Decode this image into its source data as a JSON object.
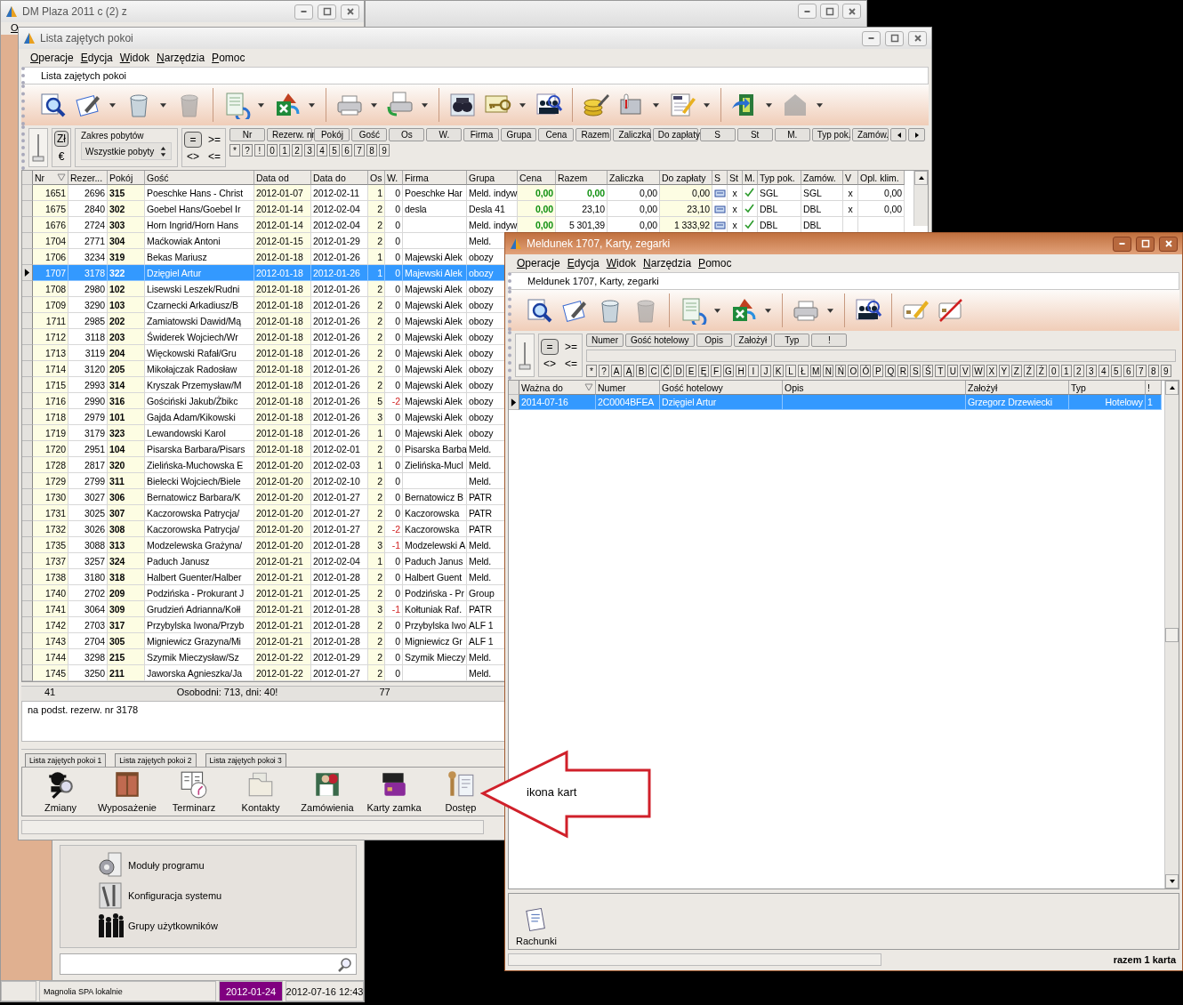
{
  "main_window": {
    "title": "DM Plaza 2011 c (2) z",
    "menu": [
      "O"
    ],
    "modules": [
      "Moduły programu",
      "Konfiguracja systemu",
      "Grupy użytkowników"
    ],
    "status_bar": {
      "location": "Magnolia SPA lokalnie",
      "work_date": "2012-01-24",
      "clock": "2012-07-16 12:43"
    }
  },
  "list_window": {
    "title": "Lista zajętych pokoi",
    "menu": [
      "Operacje",
      "Edycja",
      "Widok",
      "Narzędzia",
      "Pomoc"
    ],
    "caption": "Lista zajętych pokoi",
    "filter": {
      "currency": [
        {
          "label": "Zł",
          "selected": true
        },
        {
          "label": "€",
          "selected": false
        }
      ],
      "range_label": "Zakres pobytów",
      "range_value": "Wszystkie pobyty",
      "operators": [
        {
          "label": "=",
          "selected": true
        },
        {
          "label": ">=",
          "selected": false
        },
        {
          "label": "<>",
          "selected": false
        },
        {
          "label": "<=",
          "selected": false
        }
      ],
      "column_buttons": [
        "Nr",
        "Rezerw. nr",
        "Pokój",
        "Gość",
        "Os",
        "W.",
        "Firma",
        "Grupa",
        "Cena",
        "Razem",
        "Zaliczka",
        "Do zapłaty",
        "S",
        "St",
        "M.",
        "Typ pok.",
        "Zamów."
      ],
      "quick_keys": [
        "*",
        "?",
        "!",
        "0",
        "1",
        "2",
        "3",
        "4",
        "5",
        "6",
        "7",
        "8",
        "9"
      ]
    },
    "table": {
      "columns": [
        {
          "label": "Nr",
          "sorted": true
        },
        {
          "label": "Rezer...",
          "sorted": false
        },
        {
          "label": "Pokój",
          "sorted": false
        },
        {
          "label": "Gość",
          "sorted": false
        },
        {
          "label": "Data od",
          "sorted": false
        },
        {
          "label": "Data do",
          "sorted": false
        },
        {
          "label": "Os",
          "sorted": false
        },
        {
          "label": "W.",
          "sorted": false
        },
        {
          "label": "Firma",
          "sorted": false
        },
        {
          "label": "Grupa",
          "sorted": false
        },
        {
          "label": "Cena",
          "sorted": false
        },
        {
          "label": "Razem",
          "sorted": false
        },
        {
          "label": "Zaliczka",
          "sorted": false
        },
        {
          "label": "Do zapłaty",
          "sorted": false
        },
        {
          "label": "S",
          "sorted": false
        },
        {
          "label": "St",
          "sorted": false
        },
        {
          "label": "M.",
          "sorted": false
        },
        {
          "label": "Typ pok.",
          "sorted": false
        },
        {
          "label": "Zamów.",
          "sorted": false
        },
        {
          "label": "V",
          "sorted": false
        },
        {
          "label": "Opl. klim.",
          "sorted": false
        }
      ],
      "rows": [
        {
          "nr": "1651",
          "rez": "2696",
          "room": "315",
          "guest": "Poeschke Hans - Christ",
          "from": "2012-01-07",
          "to": "2012-02-11",
          "persons": "1",
          "w": "0",
          "w_red": false,
          "company": "Poeschke Har",
          "group": "Meld. indyw",
          "selected": false,
          "charges": {
            "cena": "0,00",
            "razem": "0,00",
            "razem_green": true,
            "zaliczka": "0,00",
            "do_zaplaty": "0,00",
            "st": "x",
            "m_checked": true,
            "typ_pok": "SGL",
            "zamow": "SGL",
            "v": "x",
            "opl": "0,00"
          }
        },
        {
          "nr": "1675",
          "rez": "2840",
          "room": "302",
          "guest": "Goebel Hans/Goebel Ir",
          "from": "2012-01-14",
          "to": "2012-02-04",
          "persons": "2",
          "w": "0",
          "w_red": false,
          "company": "desla",
          "group": "Desla 41",
          "selected": false,
          "charges": {
            "cena": "0,00",
            "razem": "23,10",
            "razem_green": false,
            "zaliczka": "0,00",
            "do_zaplaty": "23,10",
            "st": "x",
            "m_checked": true,
            "typ_pok": "DBL",
            "zamow": "DBL",
            "v": "x",
            "opl": "0,00"
          }
        },
        {
          "nr": "1676",
          "rez": "2724",
          "room": "303",
          "guest": "Horn Ingrid/Horn Hans",
          "from": "2012-01-14",
          "to": "2012-02-04",
          "persons": "2",
          "w": "0",
          "w_red": false,
          "group": "Meld. indyw",
          "selected": false,
          "charges": {
            "cena": "0,00",
            "razem": "5 301,39",
            "razem_green": false,
            "zaliczka": "0,00",
            "do_zaplaty": "1 333,92",
            "st": "x",
            "m_checked": true,
            "typ_pok": "DBL",
            "zamow": "DBL"
          }
        },
        {
          "nr": "1704",
          "rez": "2771",
          "room": "304",
          "guest": "Maćkowiak Antoni",
          "from": "2012-01-15",
          "to": "2012-01-29",
          "persons": "2",
          "w": "0",
          "w_red": false,
          "group": "Meld.",
          "selected": false
        },
        {
          "nr": "1706",
          "rez": "3234",
          "room": "319",
          "guest": "Bekas Mariusz",
          "from": "2012-01-18",
          "to": "2012-01-26",
          "persons": "1",
          "w": "0",
          "w_red": false,
          "company": "Majewski Alek",
          "group": "obozy",
          "selected": false
        },
        {
          "nr": "1707",
          "rez": "3178",
          "room": "322",
          "guest": "Dzięgiel Artur",
          "from": "2012-01-18",
          "to": "2012-01-26",
          "persons": "1",
          "w": "0",
          "w_red": false,
          "company": "Majewski Alek",
          "group": "obozy",
          "selected": true
        },
        {
          "nr": "1708",
          "rez": "2980",
          "room": "102",
          "guest": "Lisewski Leszek/Rudni",
          "from": "2012-01-18",
          "to": "2012-01-26",
          "persons": "2",
          "w": "0",
          "w_red": false,
          "company": "Majewski Alek",
          "group": "obozy",
          "selected": false
        },
        {
          "nr": "1709",
          "rez": "3290",
          "room": "103",
          "guest": "Czarnecki Arkadiusz/B",
          "from": "2012-01-18",
          "to": "2012-01-26",
          "persons": "2",
          "w": "0",
          "w_red": false,
          "company": "Majewski Alek",
          "group": "obozy",
          "selected": false
        },
        {
          "nr": "1711",
          "rez": "2985",
          "room": "202",
          "guest": "Zamiatowski Dawid/Mą",
          "from": "2012-01-18",
          "to": "2012-01-26",
          "persons": "2",
          "w": "0",
          "w_red": false,
          "company": "Majewski Alek",
          "group": "obozy",
          "selected": false
        },
        {
          "nr": "1712",
          "rez": "3118",
          "room": "203",
          "guest": "Świderek Wojciech/Wr",
          "from": "2012-01-18",
          "to": "2012-01-26",
          "persons": "2",
          "w": "0",
          "w_red": false,
          "company": "Majewski Alek",
          "group": "obozy",
          "selected": false
        },
        {
          "nr": "1713",
          "rez": "3119",
          "room": "204",
          "guest": "Więckowski Rafał/Gru",
          "from": "2012-01-18",
          "to": "2012-01-26",
          "persons": "2",
          "w": "0",
          "w_red": false,
          "company": "Majewski Alek",
          "group": "obozy",
          "selected": false
        },
        {
          "nr": "1714",
          "rez": "3120",
          "room": "205",
          "guest": "Mikołajczak Radosław",
          "from": "2012-01-18",
          "to": "2012-01-26",
          "persons": "2",
          "w": "0",
          "w_red": false,
          "company": "Majewski Alek",
          "group": "obozy",
          "selected": false
        },
        {
          "nr": "1715",
          "rez": "2993",
          "room": "314",
          "guest": "Kryszak Przemysław/M",
          "from": "2012-01-18",
          "to": "2012-01-26",
          "persons": "2",
          "w": "0",
          "w_red": false,
          "company": "Majewski Alek",
          "group": "obozy",
          "selected": false
        },
        {
          "nr": "1716",
          "rez": "2990",
          "room": "316",
          "guest": "Gościński Jakub/Żbikc",
          "from": "2012-01-18",
          "to": "2012-01-26",
          "persons": "5",
          "w": "-2",
          "w_red": true,
          "company": "Majewski Alek",
          "group": "obozy",
          "selected": false
        },
        {
          "nr": "1718",
          "rez": "2979",
          "room": "101",
          "guest": "Gajda Adam/Kikowski",
          "from": "2012-01-18",
          "to": "2012-01-26",
          "persons": "3",
          "w": "0",
          "w_red": false,
          "company": "Majewski Alek",
          "group": "obozy",
          "selected": false
        },
        {
          "nr": "1719",
          "rez": "3179",
          "room": "323",
          "guest": "Lewandowski Karol",
          "from": "2012-01-18",
          "to": "2012-01-26",
          "persons": "1",
          "w": "0",
          "w_red": false,
          "company": "Majewski Alek",
          "group": "obozy",
          "selected": false
        },
        {
          "nr": "1720",
          "rez": "2951",
          "room": "104",
          "guest": "Pisarska Barbara/Pisars",
          "from": "2012-01-18",
          "to": "2012-02-01",
          "persons": "2",
          "w": "0",
          "w_red": false,
          "company": "Pisarska Barba",
          "group": "Meld.",
          "selected": false
        },
        {
          "nr": "1728",
          "rez": "2817",
          "room": "320",
          "guest": "Zielińska-Muchowska E",
          "from": "2012-01-20",
          "to": "2012-02-03",
          "persons": "1",
          "w": "0",
          "w_red": false,
          "company": "Zielińska-Mucl",
          "group": "Meld.",
          "selected": false
        },
        {
          "nr": "1729",
          "rez": "2799",
          "room": "311",
          "guest": "Bielecki Wojciech/Biele",
          "from": "2012-01-20",
          "to": "2012-02-10",
          "persons": "2",
          "w": "0",
          "w_red": false,
          "group": "Meld.",
          "selected": false
        },
        {
          "nr": "1730",
          "rez": "3027",
          "room": "306",
          "guest": "Bernatowicz Barbara/K",
          "from": "2012-01-20",
          "to": "2012-01-27",
          "persons": "2",
          "w": "0",
          "w_red": false,
          "company": "Bernatowicz B",
          "group": "PATR",
          "selected": false
        },
        {
          "nr": "1731",
          "rez": "3025",
          "room": "307",
          "guest": "Kaczorowska Patrycja/",
          "from": "2012-01-20",
          "to": "2012-01-27",
          "persons": "2",
          "w": "0",
          "w_red": false,
          "company": "Kaczorowska",
          "group": "PATR",
          "selected": false
        },
        {
          "nr": "1732",
          "rez": "3026",
          "room": "308",
          "guest": "Kaczorowska Patrycja/",
          "from": "2012-01-20",
          "to": "2012-01-27",
          "persons": "2",
          "w": "-2",
          "w_red": true,
          "company": "Kaczorowska",
          "group": "PATR",
          "selected": false
        },
        {
          "nr": "1735",
          "rez": "3088",
          "room": "313",
          "guest": "Modzelewska Grażyna/",
          "from": "2012-01-20",
          "to": "2012-01-28",
          "persons": "3",
          "w": "-1",
          "w_red": true,
          "company": "Modzelewski A",
          "group": "Meld.",
          "selected": false
        },
        {
          "nr": "1737",
          "rez": "3257",
          "room": "324",
          "guest": "Paduch Janusz",
          "from": "2012-01-21",
          "to": "2012-02-04",
          "persons": "1",
          "w": "0",
          "w_red": false,
          "company": "Paduch Janus",
          "group": "Meld.",
          "selected": false
        },
        {
          "nr": "1738",
          "rez": "3180",
          "room": "318",
          "guest": "Halbert Guenter/Halber",
          "from": "2012-01-21",
          "to": "2012-01-28",
          "persons": "2",
          "w": "0",
          "w_red": false,
          "company": "Halbert Guent",
          "group": "Meld.",
          "selected": false
        },
        {
          "nr": "1740",
          "rez": "2702",
          "room": "209",
          "guest": "Podzińska - Prokurant J",
          "from": "2012-01-21",
          "to": "2012-01-25",
          "persons": "2",
          "w": "0",
          "w_red": false,
          "company": "Podzińska - Pr",
          "group": "Group",
          "selected": false
        },
        {
          "nr": "1741",
          "rez": "3064",
          "room": "309",
          "guest": "Grudzień Adrianna/Kołł",
          "from": "2012-01-21",
          "to": "2012-01-28",
          "persons": "3",
          "w": "-1",
          "w_red": true,
          "company": "Kołtuniak Raf.",
          "group": "PATR",
          "selected": false
        },
        {
          "nr": "1742",
          "rez": "2703",
          "room": "317",
          "guest": "Przybylska Iwona/Przyb",
          "from": "2012-01-21",
          "to": "2012-01-28",
          "persons": "2",
          "w": "0",
          "w_red": false,
          "company": "Przybylska Iwo",
          "group": "ALF 1",
          "selected": false
        },
        {
          "nr": "1743",
          "rez": "2704",
          "room": "305",
          "guest": "Migniewicz Grazyna/Mi",
          "from": "2012-01-21",
          "to": "2012-01-28",
          "persons": "2",
          "w": "0",
          "w_red": false,
          "company": "Migniewicz Gr",
          "group": "ALF 1",
          "selected": false
        },
        {
          "nr": "1744",
          "rez": "3298",
          "room": "215",
          "guest": "Szymik Mieczysław/Sz",
          "from": "2012-01-22",
          "to": "2012-01-29",
          "persons": "2",
          "w": "0",
          "w_red": false,
          "company": "Szymik Mieczy",
          "group": "Meld.",
          "selected": false
        },
        {
          "nr": "1745",
          "rez": "3250",
          "room": "211",
          "guest": "Jaworska Agnieszka/Ja",
          "from": "2012-01-22",
          "to": "2012-01-27",
          "persons": "2",
          "w": "0",
          "w_red": false,
          "group": "Meld.",
          "selected": false
        }
      ]
    },
    "totals": {
      "count": "41",
      "stays": "Osobodni: 713, dni: 40!",
      "guests": "77"
    },
    "note": "na podst. rezerw. nr 3178",
    "tabs": [
      "Lista zajętych pokoi 1",
      "Lista zajętych pokoi 2",
      "Lista zajętych pokoi 3"
    ],
    "modules": [
      "Zmiany",
      "Wyposażenie",
      "Terminarz",
      "Kontakty",
      "Zamówienia",
      "Karty zamka",
      "Dostęp"
    ]
  },
  "card_window": {
    "title": "Meldunek 1707, Karty, zegarki",
    "menu": [
      "Operacje",
      "Edycja",
      "Widok",
      "Narzędzia",
      "Pomoc"
    ],
    "caption": "Meldunek 1707, Karty, zegarki",
    "filter": {
      "operators": [
        {
          "label": "=",
          "selected": true
        },
        {
          "label": ">=",
          "selected": false
        },
        {
          "label": "<>",
          "selected": false
        },
        {
          "label": "<=",
          "selected": false
        }
      ],
      "column_buttons": [
        "Numer",
        "Gość hotelowy",
        "Opis",
        "Założył",
        "Typ",
        "!"
      ],
      "quick_keys": [
        "*",
        "?",
        "A",
        "Ą",
        "B",
        "C",
        "Ć",
        "D",
        "E",
        "Ę",
        "F",
        "G",
        "H",
        "I",
        "J",
        "K",
        "L",
        "Ł",
        "M",
        "N",
        "Ń",
        "O",
        "Ó",
        "P",
        "Q",
        "R",
        "S",
        "Ś",
        "T",
        "U",
        "V",
        "W",
        "X",
        "Y",
        "Z",
        "Ź",
        "Ż",
        "0",
        "1",
        "2",
        "3",
        "4",
        "5",
        "6",
        "7",
        "8",
        "9"
      ]
    },
    "table": {
      "columns": [
        {
          "label": "Ważna do",
          "sorted": true
        },
        {
          "label": "Numer",
          "sorted": false
        },
        {
          "label": "Gość hotelowy",
          "sorted": false
        },
        {
          "label": "Opis",
          "sorted": false
        },
        {
          "label": "Założył",
          "sorted": false
        },
        {
          "label": "Typ",
          "sorted": false
        },
        {
          "label": "!",
          "sorted": false
        }
      ],
      "rows": [
        {
          "valid_to": "2014-07-16",
          "number": "2C0004BFEA",
          "guest": "Dzięgiel Artur",
          "created_by": "Grzegorz Drzewiecki",
          "type": "Hotelowy",
          "flag": "1",
          "selected": true
        }
      ]
    },
    "modules": [
      "Rachunki"
    ],
    "status": "razem 1 karta"
  },
  "annotation": {
    "text": "ikona kart"
  }
}
